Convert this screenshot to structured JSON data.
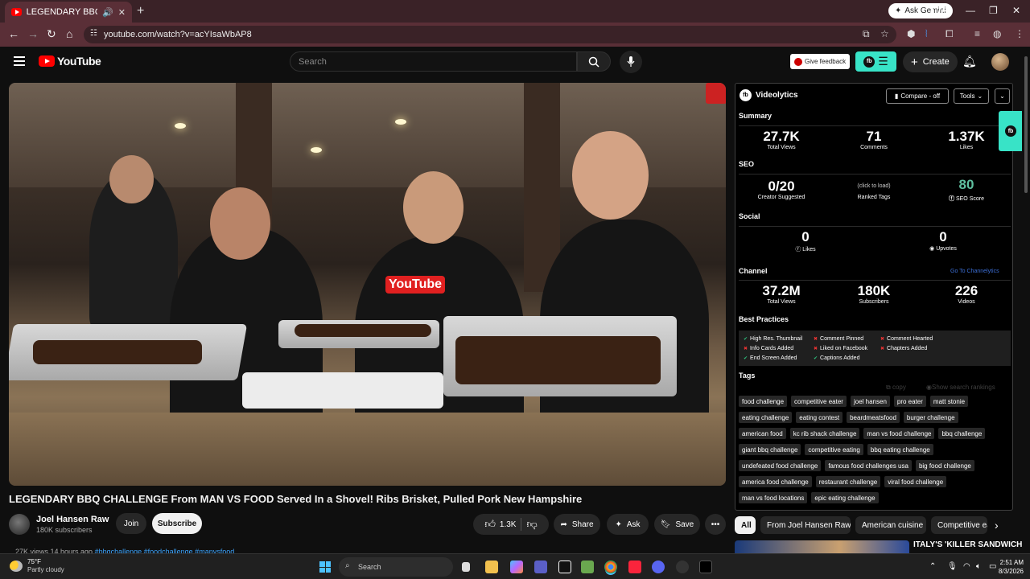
{
  "browser": {
    "tab_title": "LEGENDARY BBQ CHALLEN",
    "new_tab": "+",
    "url": "youtube.com/watch?v=acYIsaWbAP8",
    "ask_gemini": "Ask Gemini",
    "overlay_counter": "1/5"
  },
  "header": {
    "logo_text": "YouTube",
    "search_placeholder": "Search",
    "feedback_label": "Give feedback",
    "create_label": "Create"
  },
  "video": {
    "title": "LEGENDARY BBQ CHALLENGE From MAN VS FOOD Served In a Shovel! Ribs Brisket, Pulled Pork New Hampshire",
    "shirt_text": "YouTube",
    "channel_name": "Joel Hansen Raw",
    "channel_subs": "180K subscribers",
    "join_label": "Join",
    "subscribe_label": "Subscribe",
    "likes_label": "1.3K",
    "share_label": "Share",
    "ask_label": "Ask",
    "save_label": "Save",
    "desc_stats": "27K views  14 hours ago",
    "desc_tags": "#bbqchallenge #foodchallenge #manvsfood"
  },
  "videolytics": {
    "name": "Videolytics",
    "compare_label": "Compare - off",
    "tools_label": "Tools",
    "summary_title": "Summary",
    "summary": [
      {
        "value": "27.7K",
        "label": "Total Views"
      },
      {
        "value": "71",
        "label": "Comments"
      },
      {
        "value": "1.37K",
        "label": "Likes"
      }
    ],
    "seo_title": "SEO",
    "seo": {
      "creator_value": "0/20",
      "creator_label": "Creator Suggested",
      "ranked_value": "(click to load)",
      "ranked_label": "Ranked Tags",
      "score_value": "80",
      "score_label": "SEO Score"
    },
    "social_title": "Social",
    "social": {
      "likes_value": "0",
      "likes_label": "Likes",
      "upvotes_value": "0",
      "upvotes_label": "Upvotes"
    },
    "channel_title": "Channel",
    "channel_link": "Go To Channelytics",
    "channel": [
      {
        "value": "37.2M",
        "label": "Total Views"
      },
      {
        "value": "180K",
        "label": "Subscribers"
      },
      {
        "value": "226",
        "label": "Videos"
      }
    ],
    "best_practices_title": "Best Practices",
    "best_practices": [
      {
        "label": "High Res. Thumbnail",
        "status": "ok"
      },
      {
        "label": "Comment Pinned",
        "status": "no"
      },
      {
        "label": "Comment Hearted",
        "status": "no"
      },
      {
        "label": "Info Cards Added",
        "status": "no"
      },
      {
        "label": "Liked on Facebook",
        "status": "no"
      },
      {
        "label": "Chapters Added",
        "status": "no"
      },
      {
        "label": "End Screen Added",
        "status": "ok"
      },
      {
        "label": "Captions Added",
        "status": "ok"
      }
    ],
    "tags_title": "Tags",
    "copy_label": "copy",
    "rankings_label": "Show search rankings",
    "tags": [
      "food challenge",
      "competitive eater",
      "joel hansen",
      "pro eater",
      "matt stonie",
      "eating challenge",
      "eating contest",
      "beardmeatsfood",
      "burger challenge",
      "american food",
      "kc rib shack challenge",
      "man vs food challenge",
      "bbq challenge",
      "giant bbq challenge",
      "competitive eating",
      "bbq eating challenge",
      "undefeated food challenge",
      "famous food challenges usa",
      "big food challenge",
      "america food challenge",
      "restaurant challenge",
      "viral food challenge",
      "man vs food locations",
      "epic eating challenge"
    ]
  },
  "chips": [
    "All",
    "From Joel Hansen Raw",
    "American cuisine",
    "Competitive eating"
  ],
  "recommendation_title": "ITALY'S 'KILLER SANDWICH",
  "taskbar": {
    "temp": "75°F",
    "condition": "Partly cloudy",
    "search_label": "Search",
    "time": "2:51 AM",
    "date": "8/3/2026"
  }
}
